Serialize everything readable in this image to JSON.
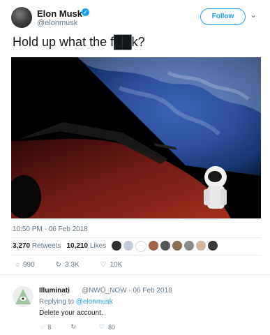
{
  "tweet": {
    "display_name": "Elon Musk",
    "handle": "@elonmusk",
    "follow_label": "Follow",
    "text": "Hold up what the f██k?",
    "timestamp": "10:50 PM - 06 Feb 2018",
    "retweets": "3,270",
    "retweets_label": "Retweets",
    "likes": "10,210",
    "likes_label": "Likes",
    "reply_count": "990",
    "retweet_count": "3.3K",
    "like_count": "10K",
    "icons": {
      "verified": "verified-badge-icon",
      "reply": "reply-icon",
      "retweet": "retweet-icon",
      "like": "heart-icon",
      "more": "chevron-down-icon"
    }
  },
  "reply": {
    "display_name": "Illuminati",
    "handle_date": "@NWO_NOW · 06 Feb 2018",
    "replying_to_label": "Replying to",
    "replying_to": "@elonmusk",
    "text": "Delete your account.",
    "reply_count": "8",
    "retweet_count": "",
    "like_count": "80"
  },
  "colors": {
    "accent": "#1da1f2",
    "text": "#14171a",
    "muted": "#657786"
  }
}
